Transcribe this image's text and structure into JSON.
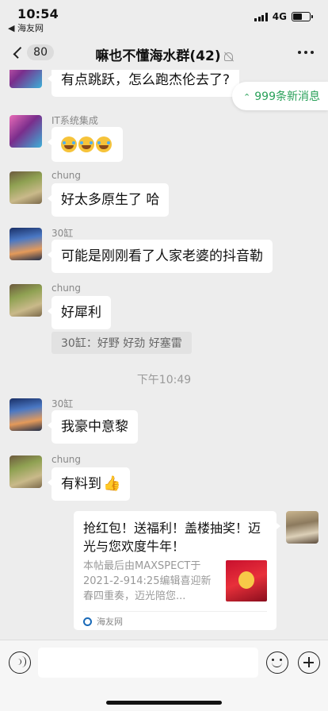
{
  "status_bar": {
    "time": "10:54",
    "back_app": "◀ 海友网",
    "network": "4G"
  },
  "nav": {
    "back_count": "80",
    "title": "嘛也不懂海水群(42)"
  },
  "new_messages": {
    "label": "999条新消息"
  },
  "messages": [
    {
      "sender": "",
      "text": "有点跳跃，怎么跑杰伦去了?"
    },
    {
      "sender": "IT系统集成",
      "text": ""
    },
    {
      "sender": "chung",
      "text": "好太多原生了 哈"
    },
    {
      "sender": "30缸",
      "text": "可能是刚刚看了人家老婆的抖音勒"
    },
    {
      "sender": "chung",
      "text": "好犀利",
      "quote": "30缸：好野 好劲  好塞雷"
    },
    {
      "sender": "30缸",
      "text": "我豪中意黎"
    },
    {
      "sender": "chung",
      "text": "有料到"
    }
  ],
  "timestamp": "下午10:49",
  "link_card": {
    "title": "抢红包！送福利！盖楼抽奖！迈光与您欢度牛年！",
    "description": "本帖最后由MAXSPECT于2021-2-914:25编辑喜迎新春四重奏，迈光陪您...",
    "source": "海友网"
  }
}
